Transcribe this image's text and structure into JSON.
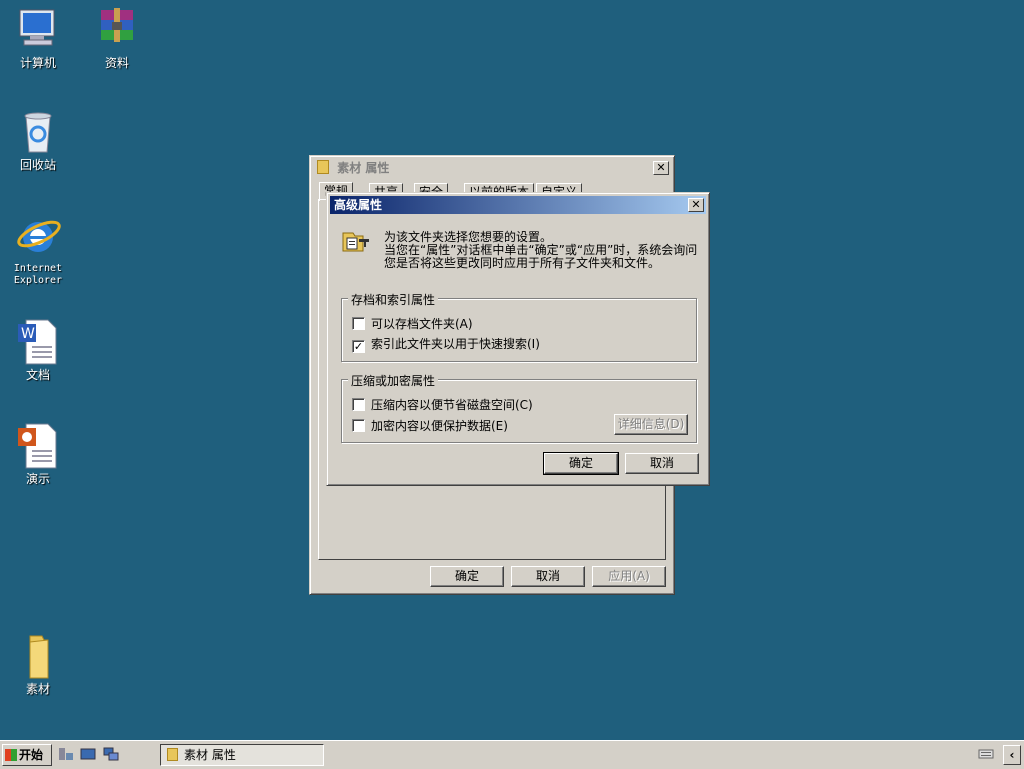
{
  "desktop": {
    "icons": [
      {
        "label": "计算机"
      },
      {
        "label": "资料"
      },
      {
        "label": "回收站"
      },
      {
        "label": "Internet\nExplorer"
      },
      {
        "label": "文档"
      },
      {
        "label": "演示"
      },
      {
        "label": "素材"
      }
    ]
  },
  "properties_window": {
    "title": "素材 属性",
    "tabs": [
      "常规",
      "共享",
      "安全",
      "以前的版本",
      "自定义"
    ],
    "ok": "确定",
    "cancel": "取消",
    "apply": "应用(A)"
  },
  "advanced_dialog": {
    "title": "高级属性",
    "intro_line1": "为该文件夹选择您想要的设置。",
    "intro_line2": "当您在“属性”对话框中单击“确定”或“应用”时，系统会询问您是否将这些更改同时应用于所有子文件夹和文件。",
    "archive_group": {
      "label": "存档和索引属性",
      "options": [
        {
          "label": "可以存档文件夹(A)",
          "checked": false
        },
        {
          "label": "索引此文件夹以用于快速搜索(I)",
          "checked": true
        }
      ]
    },
    "compress_group": {
      "label": "压缩或加密属性",
      "options": [
        {
          "label": "压缩内容以便节省磁盘空间(C)",
          "checked": false
        },
        {
          "label": "加密内容以便保护数据(E)",
          "checked": false
        }
      ],
      "details": "详细信息(D)"
    },
    "ok": "确定",
    "cancel": "取消"
  },
  "taskbar": {
    "start": "开始",
    "task": "素材 属性"
  }
}
